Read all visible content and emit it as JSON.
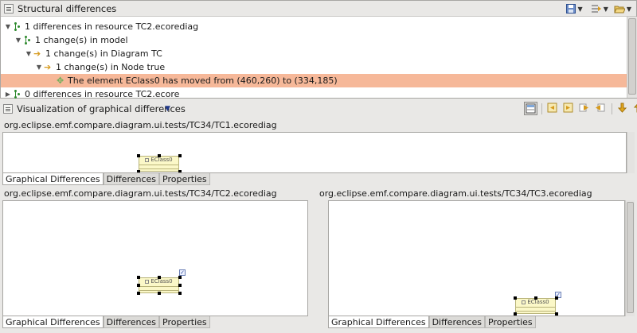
{
  "structural_view": {
    "title": "Structural differences",
    "icon": "structure-view-icon",
    "tree": [
      {
        "label": "1 differences in resource TC2.ecorediag",
        "expanded": true
      },
      {
        "label": "1 change(s) in model",
        "expanded": true
      },
      {
        "label": "1 change(s) in Diagram TC",
        "expanded": true
      },
      {
        "label": "1 change(s) in Node true",
        "expanded": true
      },
      {
        "label": "The element EClass0 has moved from (460,260) to (334,185)",
        "selected": true
      },
      {
        "label": "0 differences in resource TC2.ecore",
        "expanded": false
      }
    ]
  },
  "visualization": {
    "title": "Visualization of graphical differences",
    "top_pane": {
      "path": "org.eclipse.emf.compare.diagram.ui.tests/TC34/TC1.ecorediag",
      "node_label": "EClass0"
    },
    "left_pane": {
      "path": "org.eclipse.emf.compare.diagram.ui.tests/TC34/TC2.ecorediag",
      "node_label": "EClass0"
    },
    "right_pane": {
      "path": "org.eclipse.emf.compare.diagram.ui.tests/TC34/TC3.ecorediag",
      "node_label": "EClass0"
    },
    "tabs": [
      "Graphical Differences",
      "Differences",
      "Properties"
    ]
  },
  "colors": {
    "selection": "#f6b899",
    "node_fill": "#fbf8c8",
    "background": "#e9e8e6"
  }
}
